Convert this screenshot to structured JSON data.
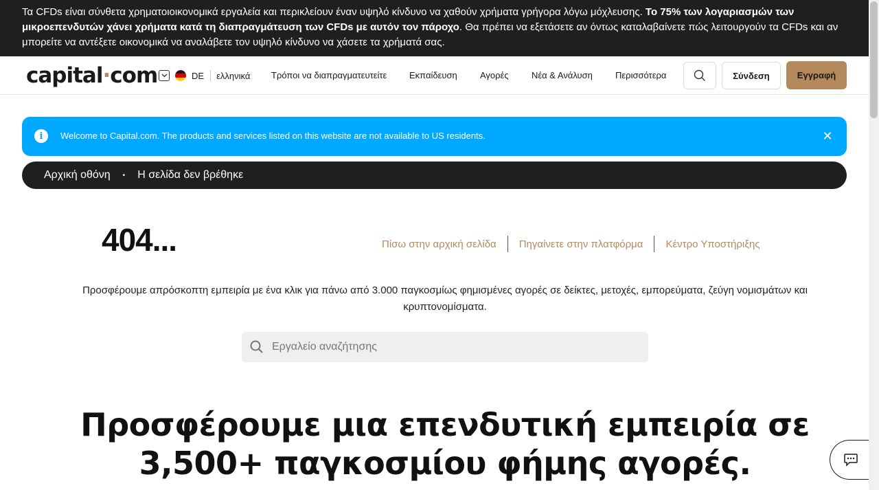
{
  "risk_banner": {
    "text_a": "Τα CFDs είναι σύνθετα χρηματοιοικονομικά εργαλεία και περικλείουν έναν υψηλό κίνδυνο να χαθούν χρήματα γρήγορα λόγω μόχλευσης. ",
    "text_bold": "Το 75% των λογαριασμών των μικροεπενδυτών χάνει χρήματα κατά τη διαπραγμάτευση των CFDs με αυτόν τον πάροχο",
    "text_b": ". Θα πρέπει να εξετάσετε αν όντως καταλαβαίνετε πώς λειτουργούν τα CFDs και αν μπορείτε να αντέξετε οικονομικά να αναλάβετε τον υψηλό κίνδυνο να χάσετε τα χρήματά σας."
  },
  "header": {
    "logo_left": "capital",
    "logo_dot": "·",
    "logo_right": "com",
    "lang_code": "DE",
    "lang_name": "ελληνικά",
    "nav": [
      "Τρόποι να διαπραγματευτείτε",
      "Εκπαίδευση",
      "Αγορές",
      "Νέα & Ανάλυση",
      "Περισσότερα"
    ],
    "login": "Σύνδεση",
    "signup": "Εγγραφή"
  },
  "notice": {
    "text": "Welcome to Capital.com. The products and services listed on this website are not available to US residents.",
    "close": "✕",
    "info": "i"
  },
  "breadcrumb": {
    "home": "Αρχική οθόνη",
    "sep": "•",
    "current": "Η σελίδα δεν βρέθηκε"
  },
  "error": {
    "code": "404...",
    "links": [
      "Πίσω στην αρχική σελίδα",
      "Πηγαίνετε στην πλατφόρμα",
      "Κέντρο Υποστήριξης"
    ]
  },
  "lead": "Προσφέρουμε απρόσκοπτη εμπειρία με ένα κλικ για πάνω από 3.000 παγκοσμίως φημισμένες αγορές σε δείκτες, μετοχές, εμπορεύματα, ζεύγη νομισμάτων και κρυπτονομίσματα.",
  "search": {
    "placeholder": "Εργαλείο αναζήτησης"
  },
  "headline": "Προσφέρουμε μια επενδυτική εμπειρία σε 3,500+ παγκοσμίου φήμης αγορές.",
  "colors": {
    "accent": "#b48a5c",
    "notice_bg": "#00a8ff",
    "dark": "#1f1f1f"
  }
}
